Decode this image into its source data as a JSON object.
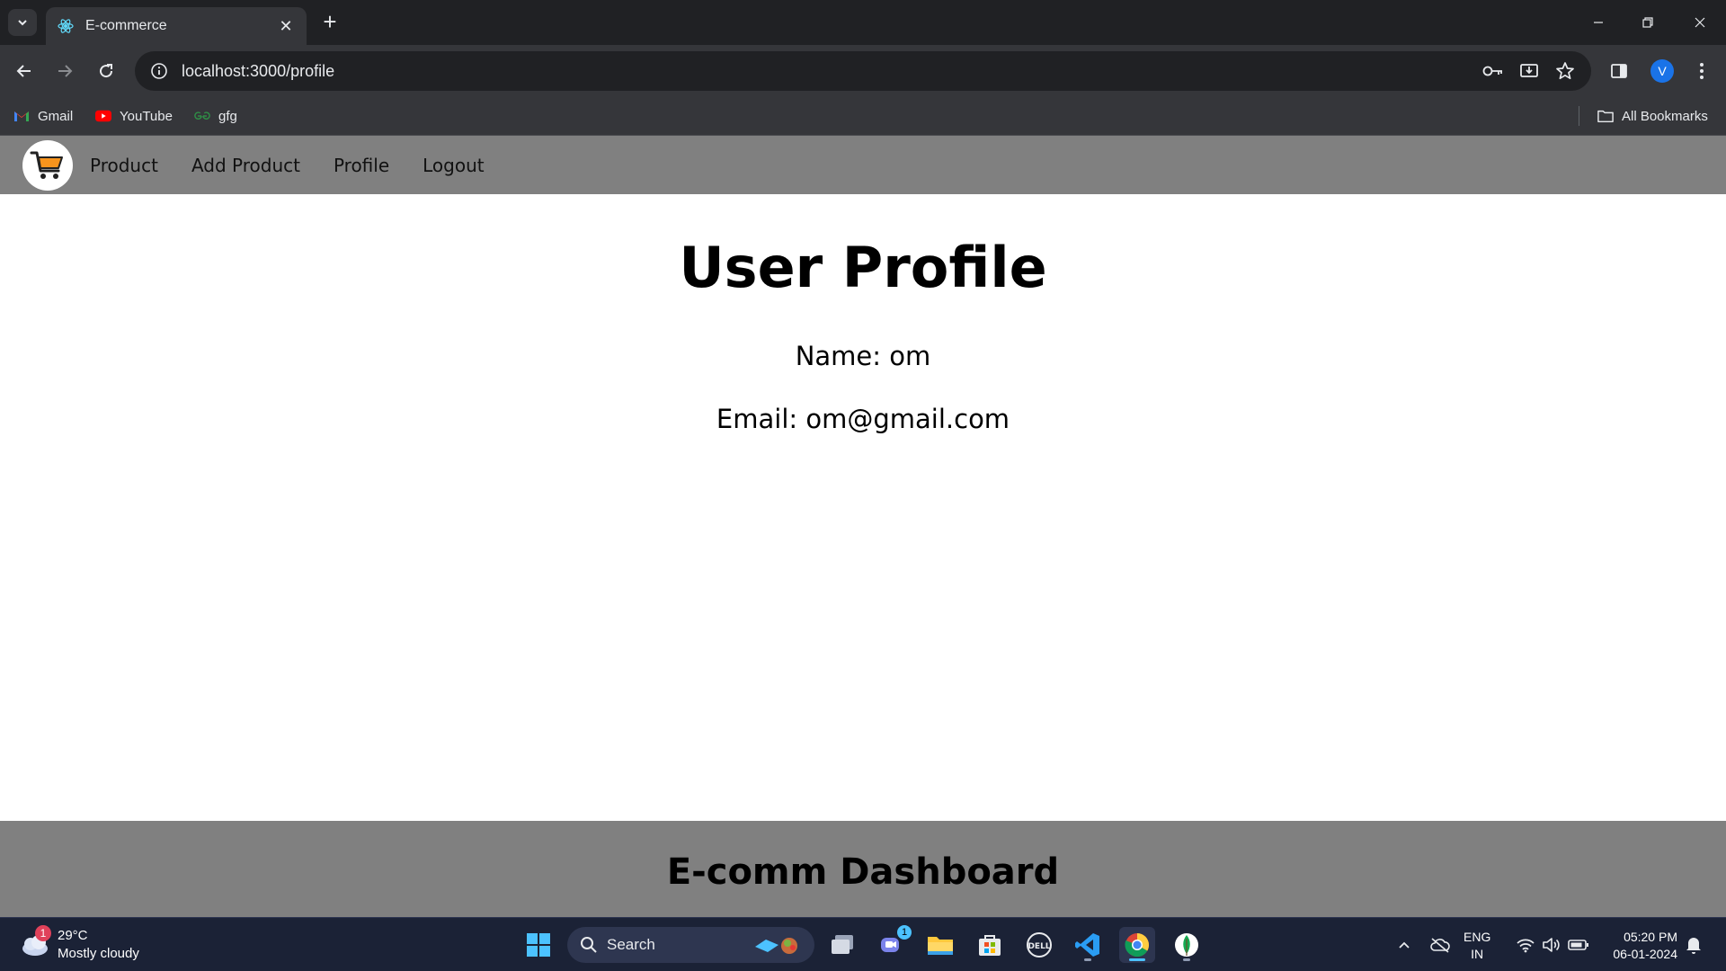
{
  "browser": {
    "tab": {
      "title": "E-commerce"
    },
    "url": "localhost:3000/profile",
    "profile_initial": "V",
    "bookmarks": [
      {
        "label": "Gmail",
        "icon": "gmail-icon"
      },
      {
        "label": "YouTube",
        "icon": "youtube-icon"
      },
      {
        "label": "gfg",
        "icon": "gfg-icon"
      }
    ],
    "all_bookmarks_label": "All Bookmarks"
  },
  "app": {
    "nav": {
      "links": [
        "Product",
        "Add Product",
        "Profile",
        "Logout"
      ]
    },
    "profile": {
      "title": "User Profile",
      "name_line": "Name: om",
      "email_line": "Email: om@gmail.com"
    },
    "footer": {
      "title": "E-comm Dashboard"
    }
  },
  "taskbar": {
    "weather": {
      "temp": "29°C",
      "desc": "Mostly cloudy",
      "badge": "1"
    },
    "search_label": "Search",
    "teams_badge": "1",
    "lang_top": "ENG",
    "lang_bottom": "IN",
    "time": "05:20 PM",
    "date": "06-01-2024"
  },
  "colors": {
    "app_nav_bg": "#808080",
    "footer_bg": "#808080",
    "chrome_dark": "#202124",
    "chrome_toolbar": "#35363a",
    "taskbar_bg": "#1b2236"
  }
}
